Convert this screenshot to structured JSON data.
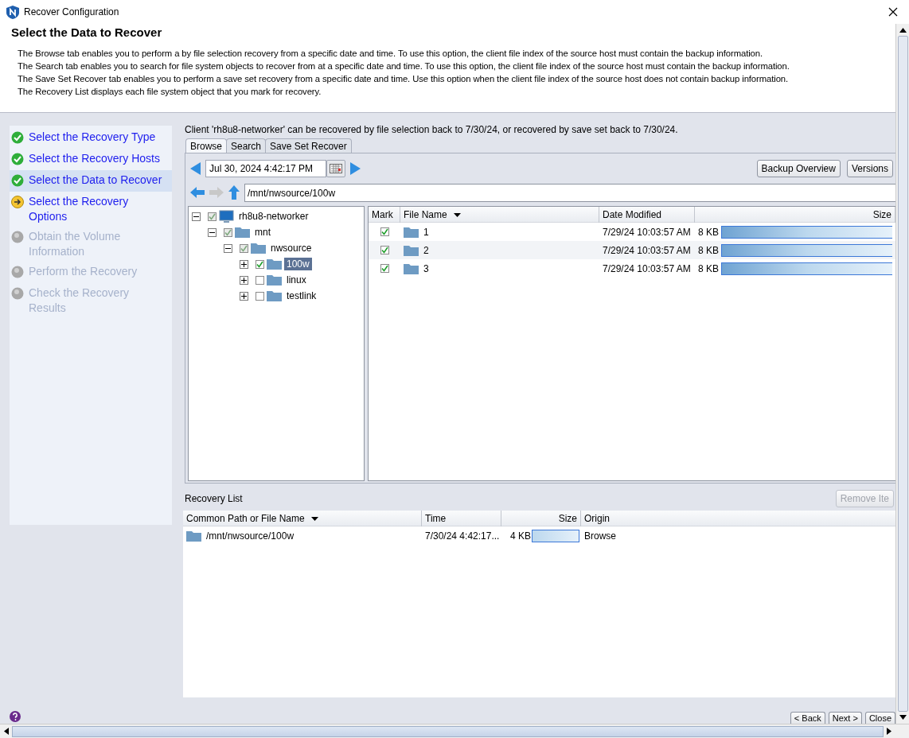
{
  "window": {
    "title": "Recover Configuration"
  },
  "header": {
    "title": "Select the Data to Recover",
    "lines": [
      "The Browse tab enables you to perform a by file selection recovery from a specific date and time. To use this option, the client file index of the source host must contain the backup information.",
      "The Search tab enables you to search for file system objects to recover from at a specific date and time. To use this option, the client file index of the source host must contain the backup information.",
      "The Save Set Recover tab enables you to perform a save set recovery from a specific date and time.  Use this option when the client file index of the source host does not contain backup information.",
      "The Recovery List displays each file system object that you mark for recovery."
    ]
  },
  "steps": [
    {
      "label": "Select the Recovery Type",
      "kind": "done",
      "selected": false
    },
    {
      "label": "Select the Recovery Hosts",
      "kind": "done",
      "selected": false
    },
    {
      "label": "Select the Data to Recover",
      "kind": "done",
      "selected": true
    },
    {
      "label": "Select the Recovery Options",
      "kind": "current",
      "selected": false
    },
    {
      "label": "Obtain the Volume Information",
      "kind": "pending",
      "selected": false
    },
    {
      "label": "Perform the Recovery",
      "kind": "pending",
      "selected": false
    },
    {
      "label": "Check the Recovery Results",
      "kind": "pending",
      "selected": false
    }
  ],
  "client_note": "Client 'rh8u8-networker' can be recovered by file selection back to 7/30/24, or recovered by save set back to 7/30/24.",
  "tabs": [
    {
      "label": "Browse",
      "selected": true
    },
    {
      "label": "Search",
      "selected": false
    },
    {
      "label": "Save Set Recover",
      "selected": false
    }
  ],
  "browse": {
    "date": "Jul 30, 2024 4:42:17 PM",
    "buttons": [
      "Backup Overview",
      "Versions"
    ],
    "path": "/mnt/nwsource/100w",
    "tree": [
      {
        "name": "rh8u8-networker",
        "kind": "host",
        "checked": true,
        "partial": true,
        "expanded": true,
        "selected": false,
        "children": [
          {
            "name": "mnt",
            "kind": "folder",
            "checked": true,
            "partial": true,
            "expanded": true,
            "selected": false,
            "children": [
              {
                "name": "nwsource",
                "kind": "folder",
                "checked": true,
                "partial": true,
                "expanded": true,
                "selected": false,
                "children": [
                  {
                    "name": "100w",
                    "kind": "folder",
                    "checked": true,
                    "partial": false,
                    "expanded": false,
                    "selected": true
                  },
                  {
                    "name": "linux",
                    "kind": "folder",
                    "checked": false,
                    "partial": false,
                    "expanded": false,
                    "selected": false
                  },
                  {
                    "name": "testlink",
                    "kind": "folder",
                    "checked": false,
                    "partial": false,
                    "expanded": false,
                    "selected": false
                  }
                ]
              }
            ]
          }
        ]
      }
    ],
    "columns": [
      "Mark",
      "File Name",
      "Date Modified",
      "Size"
    ],
    "files": [
      {
        "checked": true,
        "name": "1",
        "date": "7/29/24 10:03:57 AM",
        "size": "8 KB",
        "level": 1
      },
      {
        "checked": true,
        "name": "2",
        "date": "7/29/24 10:03:57 AM",
        "size": "8 KB",
        "level": 1
      },
      {
        "checked": true,
        "name": "3",
        "date": "7/29/24 10:03:57 AM",
        "size": "8 KB",
        "level": 1
      }
    ]
  },
  "recovery_list": {
    "title": "Recovery List",
    "remove_button": {
      "label": "Remove Ite",
      "disabled": true
    },
    "columns": [
      "Common Path or File Name",
      "Time",
      "Size",
      "Origin"
    ],
    "rows": [
      {
        "path": "/mnt/nwsource/100w",
        "time": "7/30/24 4:42:17...",
        "size": "4 KB",
        "level": 1,
        "origin": "Browse"
      }
    ]
  },
  "footer": {
    "buttons": [
      "< Back",
      "Next >",
      "Close"
    ]
  }
}
